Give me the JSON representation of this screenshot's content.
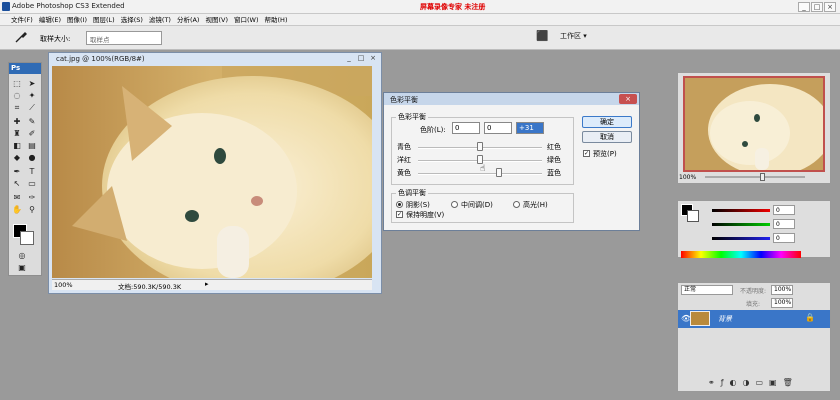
{
  "app": {
    "title": "Adobe Photoshop CS3 Extended",
    "rec_note": "屏幕录像专家 未注册",
    "win_buttons": [
      "_",
      "□",
      "×"
    ]
  },
  "menu": [
    "文件(F)",
    "编辑(E)",
    "图像(I)",
    "图层(L)",
    "选择(S)",
    "滤镜(T)",
    "分析(A)",
    "视图(V)",
    "窗口(W)",
    "帮助(H)"
  ],
  "options": {
    "sample_label": "取样大小:",
    "sample_value": "取样点",
    "workspace": "工作区 ▾"
  },
  "toolbox": {
    "logo": "Ps"
  },
  "document": {
    "title": "cat.jpg @ 100%(RGB/8#)",
    "zoom": "100%",
    "size": "文档:590.3K/590.3K"
  },
  "dialog": {
    "title": "色彩平衡",
    "group1": "色彩平衡",
    "levels_label": "色阶(L):",
    "levels": [
      "0",
      "0",
      "+31"
    ],
    "sliders": [
      {
        "left": "青色",
        "right": "红色",
        "value": 0
      },
      {
        "left": "洋红",
        "right": "绿色",
        "value": 0
      },
      {
        "left": "黄色",
        "right": "蓝色",
        "value": 31
      }
    ],
    "group2": "色调平衡",
    "tones": [
      "阴影(S)",
      "中间调(D)",
      "高光(H)"
    ],
    "selected_tone": 0,
    "preserve": "保持明度(V)",
    "ok": "确定",
    "cancel": "取消",
    "preview": "预览(P)"
  },
  "navigator": {
    "zoom": "100%"
  },
  "color_panel": {
    "values": [
      "0",
      "0",
      "0"
    ]
  },
  "layers": {
    "blend": "正常",
    "opacity_label": "不透明度:",
    "opacity": "100%",
    "fill_label": "填充:",
    "fill": "100%",
    "layer_name": "背景"
  },
  "colors": {
    "accent": "#3a76c8",
    "rec_note": "#e00000"
  }
}
